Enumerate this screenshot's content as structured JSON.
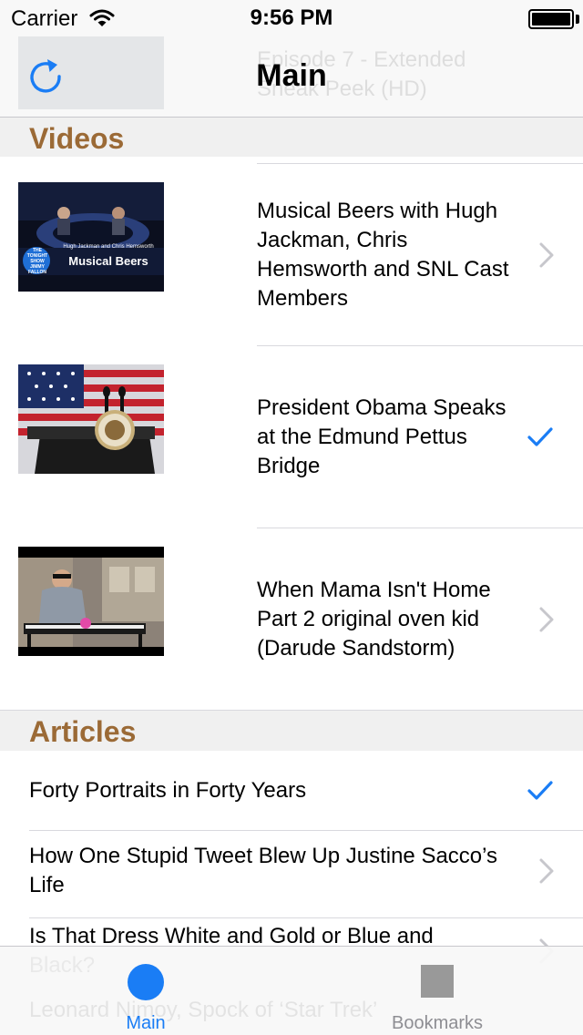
{
  "status_bar": {
    "carrier": "Carrier",
    "time": "9:56 PM",
    "icons": [
      "wifi-icon",
      "battery-icon"
    ]
  },
  "nav": {
    "title": "Main",
    "left_icon": "refresh-icon",
    "ghost_text": "Episode 7 - Extended Sneak Peek (HD)"
  },
  "colors": {
    "accent": "#1a7df5",
    "section_title": "#9b6a36",
    "section_bg": "#f0f0f0",
    "tab_inactive": "#8e8e93"
  },
  "videos": {
    "header": "Videos",
    "items": [
      {
        "title": "Musical Beers with Hugh Jackman, Chris Hemsworth and SNL Cast Members",
        "accessory": "chevron",
        "thumb_caption_top": "Hugh Jackman and Chris Hemsworth",
        "thumb_caption": "Musical Beers",
        "thumb_logo": "THE TONIGHT SHOW JIMMY FALLON"
      },
      {
        "title": "President Obama Speaks at the Edmund Pettus Bridge",
        "accessory": "checkmark"
      },
      {
        "title": "When Mama Isn't Home Part 2 original oven kid (Darude Sandstorm)",
        "accessory": "chevron"
      }
    ]
  },
  "articles": {
    "header": "Articles",
    "items": [
      {
        "title": "Forty Portraits in Forty Years",
        "accessory": "checkmark"
      },
      {
        "title": "How One Stupid Tweet Blew Up Justine Sacco’s Life",
        "accessory": "chevron"
      },
      {
        "title": "Is That Dress White and Gold or Blue and Black?",
        "accessory": "chevron"
      }
    ],
    "ghost_text": "Leonard Nimoy, Spock of ‘Star Trek’"
  },
  "tabs": [
    {
      "label": "Main",
      "icon": "circle-icon",
      "selected": true
    },
    {
      "label": "Bookmarks",
      "icon": "square-icon",
      "selected": false
    }
  ]
}
